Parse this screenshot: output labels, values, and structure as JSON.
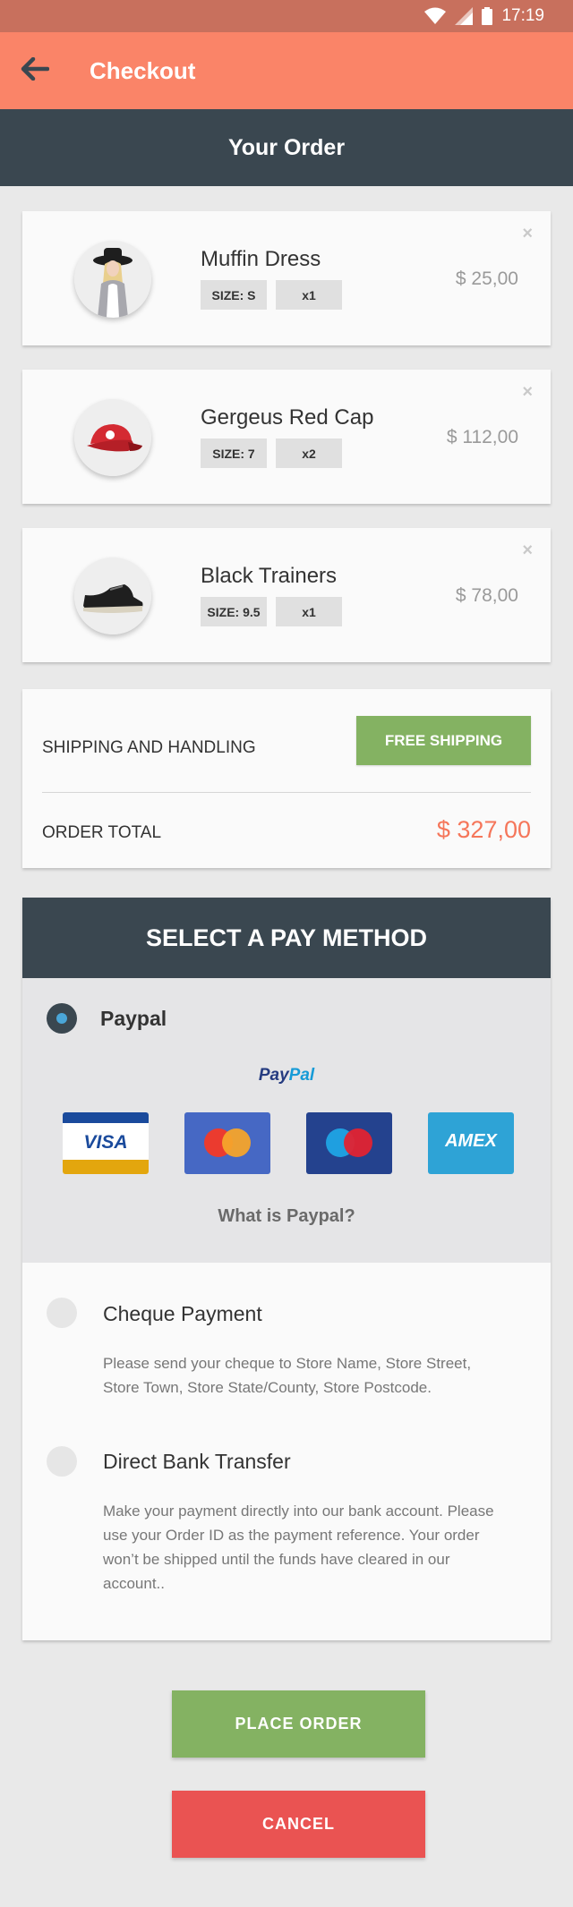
{
  "status_bar": {
    "time": "17:19"
  },
  "app_bar": {
    "title": "Checkout"
  },
  "order_header": {
    "title": "Your Order"
  },
  "items": [
    {
      "name": "Muffin Dress",
      "size": "SIZE: S",
      "qty": "x1",
      "price": "$ 25,00",
      "remove": "×",
      "image": "dress-icon"
    },
    {
      "name": "Gergeus Red Cap",
      "size": "SIZE: 7",
      "qty": "x2",
      "price": "$ 112,00",
      "remove": "×",
      "image": "cap-icon"
    },
    {
      "name": "Black Trainers",
      "size": "SIZE: 9.5",
      "qty": "x1",
      "price": "$ 78,00",
      "remove": "×",
      "image": "shoe-icon"
    }
  ],
  "totals": {
    "shipping_label": "SHIPPING AND HANDLING",
    "shipping_value": "FREE SHIPPING",
    "total_label": "ORDER TOTAL",
    "total_value": "$ 327,00"
  },
  "payment": {
    "header": "SELECT A PAY METHOD",
    "paypal": {
      "label": "Paypal",
      "logo_part1": "Pay",
      "logo_part2": "Pal",
      "cards": [
        "VISA",
        "mastercard",
        "maestro",
        "AMEX"
      ],
      "card_labels": {
        "visa": "VISA",
        "amex": "AMEX"
      },
      "what_is": "What is Paypal?"
    },
    "cheque": {
      "label": "Cheque Payment",
      "desc": "Please send your cheque to Store Name, Store Street, Store Town, Store State/County, Store Postcode."
    },
    "bank": {
      "label": "Direct Bank Transfer",
      "desc": "Make your payment directly into our bank account. Please use your Order ID as the payment reference. Your order won’t be shipped until the funds have cleared in our account.."
    },
    "selected": "paypal"
  },
  "buttons": {
    "place": "PLACE ORDER",
    "cancel": "CANCEL"
  },
  "colors": {
    "accent": "#fa8468",
    "dark": "#3a4750",
    "green": "#84b262",
    "red": "#ea5352",
    "total": "#f5765a"
  }
}
